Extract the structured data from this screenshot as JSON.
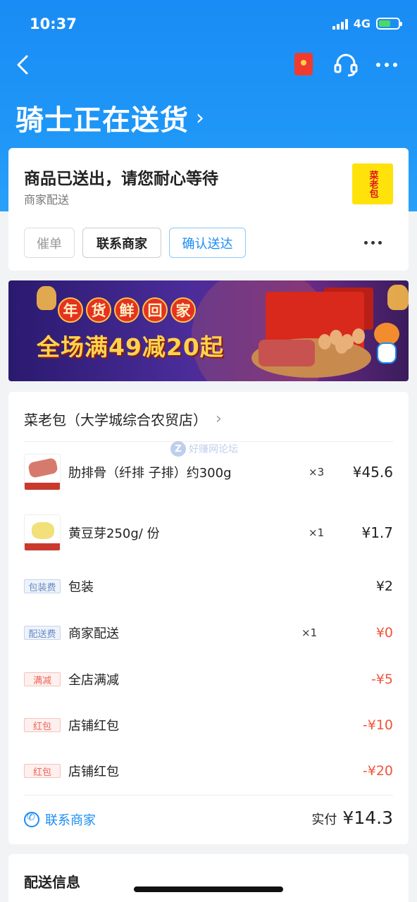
{
  "status_bar": {
    "time": "10:37",
    "network": "4G"
  },
  "header": {
    "title": "骑士正在送货",
    "title_chevron": "›"
  },
  "status_card": {
    "title": "商品已送出，请您耐心等待",
    "subtitle": "商家配送",
    "logo_text": "菜老包",
    "buttons": {
      "urge": "催单",
      "contact": "联系商家",
      "confirm": "确认送达"
    }
  },
  "banner": {
    "line1_chars": [
      "年",
      "货",
      "鲜",
      "回",
      "家"
    ],
    "line2": "全场满49减20起"
  },
  "order": {
    "shop_name": "菜老包（大学城综合农贸店）",
    "watermark": "好赚网论坛",
    "items": [
      {
        "name": "肋排骨（纤排 子排）约300g",
        "qty": "×3",
        "price": "¥45.6"
      },
      {
        "name": "黄豆芽250g/ 份",
        "qty": "×1",
        "price": "¥1.7"
      }
    ],
    "fees": [
      {
        "tag": "包装费",
        "tag_color": "blue",
        "name": "包装",
        "qty": "",
        "amount": "¥2",
        "amount_color": "default"
      },
      {
        "tag": "配送费",
        "tag_color": "blue",
        "name": "商家配送",
        "qty": "×1",
        "amount": "¥0",
        "amount_color": "red"
      },
      {
        "tag": "满减",
        "tag_color": "red",
        "name": "全店满减",
        "qty": "",
        "amount": "-¥5",
        "amount_color": "red"
      },
      {
        "tag": "红包",
        "tag_color": "red",
        "name": "店铺红包",
        "qty": "",
        "amount": "-¥10",
        "amount_color": "red"
      },
      {
        "tag": "红包",
        "tag_color": "red",
        "name": "店铺红包",
        "qty": "",
        "amount": "-¥20",
        "amount_color": "red"
      }
    ],
    "contact_label": "联系商家",
    "paid_label": "实付",
    "paid_amount": "¥14.3"
  },
  "delivery_info": {
    "title": "配送信息"
  },
  "colors": {
    "brand_blue": "#1a8cf5",
    "discount_red": "#f0553a"
  }
}
